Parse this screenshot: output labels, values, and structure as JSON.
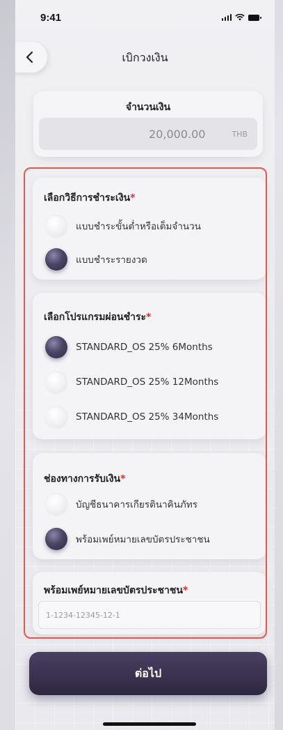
{
  "status": {
    "time": "9:41"
  },
  "header": {
    "title": "เบิกวงเงิน"
  },
  "amount": {
    "label": "จำนวนเงิน",
    "value": "20,000.00",
    "currency": "THB"
  },
  "payment_method": {
    "title": "เลือกวิธีการชำระเงิน",
    "required_mark": "*",
    "options": [
      {
        "label": "แบบชำระขั้นต่ำหรือเต็มจำนวน",
        "selected": false
      },
      {
        "label": "แบบชำระรายงวด",
        "selected": true
      }
    ]
  },
  "installment_program": {
    "title": "เลือกโปรแกรมผ่อนชำระ",
    "required_mark": "*",
    "options": [
      {
        "label": "STANDARD_OS 25% 6Months",
        "selected": true
      },
      {
        "label": "STANDARD_OS 25% 12Months",
        "selected": false
      },
      {
        "label": "STANDARD_OS 25% 34Months",
        "selected": false
      }
    ]
  },
  "receive_channel": {
    "title": "ช่องทางการรับเงิน",
    "required_mark": "*",
    "options": [
      {
        "label": "บัญชีธนาคารเกียรตินาคินภัทร",
        "selected": false
      },
      {
        "label": "พร้อมเพย์หมายเลขบัตรประชาชน",
        "selected": true
      }
    ]
  },
  "promptpay_id": {
    "title": "พร้อมเพย์หมายเลขบัตรประชาชน",
    "required_mark": "*",
    "placeholder": "1-1234-12345-12-1"
  },
  "footer": {
    "next_label": "ต่อไป"
  },
  "colors": {
    "accent": "#2e2740",
    "highlight_frame": "#e8574a",
    "required": "#d9302a"
  }
}
